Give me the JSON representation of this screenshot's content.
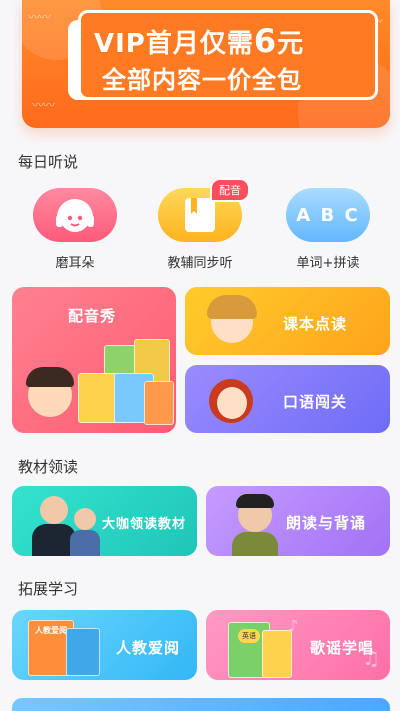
{
  "banner": {
    "line1_prefix": "VIP首月仅需",
    "line1_number": "6",
    "line1_suffix": "元",
    "line2": "全部内容一价全包"
  },
  "daily": {
    "title": "每日听说",
    "items": [
      {
        "label": "磨耳朵",
        "icon": "headphones-icon"
      },
      {
        "label": "教辅同步听",
        "icon": "book-icon",
        "tag": "配音"
      },
      {
        "label": "单词+拼读",
        "icon": "abc-icon",
        "abc": "A B C"
      }
    ],
    "tiles": {
      "dubbing": "配音秀",
      "textbook_reading": "课本点读",
      "oral": "口语闯关"
    }
  },
  "textbook": {
    "title": "教材领读",
    "tiles": {
      "expert": "大咖领读教材",
      "recite": "朗读与背诵"
    }
  },
  "extend": {
    "title": "拓展学习",
    "tiles": {
      "pep": "人教爱阅",
      "songs": "歌谣学唱"
    },
    "book_cover_text": "人教爱阅",
    "book_badge": "英语"
  },
  "colors": {
    "banner": "#ff7a22",
    "red": "#ff5b73",
    "orange": "#ffa31c",
    "purple": "#6f6cf6",
    "teal": "#1fc6b8",
    "violet": "#9f73f5",
    "sky": "#33b7f5",
    "pink": "#ff6fa7"
  }
}
